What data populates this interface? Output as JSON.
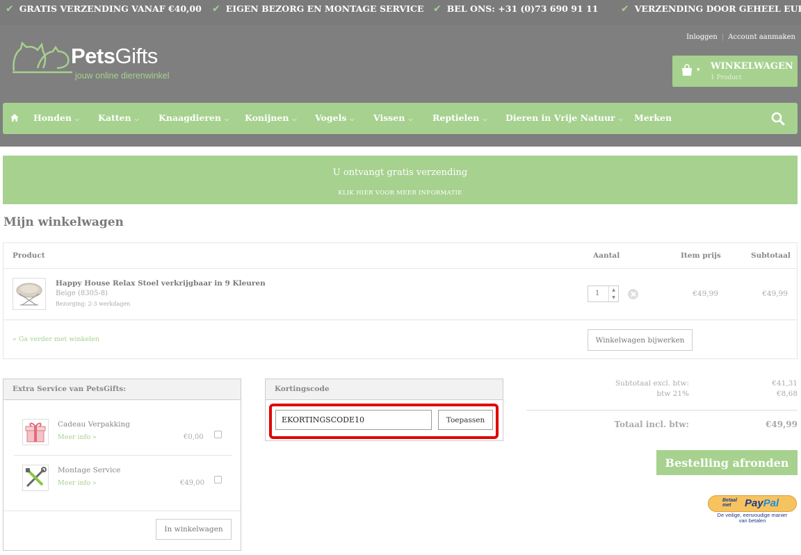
{
  "topbar": {
    "usps": [
      "GRATIS VERZENDING VANAF €40,00",
      "EIGEN BEZORG EN MONTAGE SERVICE",
      "BEL ONS: +31 (0)73 690 91 11",
      "VERZENDING DOOR GEHEEL EUROPA"
    ]
  },
  "header": {
    "logo_main": "Pets",
    "logo_light": "Gifts",
    "logo_tagline": "jouw online dierenwinkel",
    "login": "Inloggen",
    "register": "Account aanmaken",
    "cart_label": "WINKELWAGEN",
    "cart_count": "1 Product"
  },
  "nav": {
    "items": [
      "Honden",
      "Katten",
      "Knaagdieren",
      "Konijnen",
      "Vogels",
      "Vissen",
      "Reptielen",
      "Dieren in Vrije Natuur",
      "Merken"
    ]
  },
  "banner": {
    "title": "U ontvangt gratis verzending",
    "link": "KLIK HIER VOOR MEER INFORMATIE"
  },
  "page_title": "Mijn winkelwagen",
  "cart": {
    "headers": {
      "product": "Product",
      "qty": "Aantal",
      "price": "Item prijs",
      "subtotal": "Subtotaal"
    },
    "item": {
      "name": "Happy House Relax Stoel verkrijgbaar in 9 Kleuren",
      "variant": "Beige (8305-8)",
      "delivery": "Bezorging: 2-3 werkdagen",
      "qty": "1",
      "price": "€49,99",
      "subtotal": "€49,99"
    },
    "continue": "« Ga verder met winkelen",
    "update": "Winkelwagen bijwerken"
  },
  "extra": {
    "title": "Extra Service van PetsGifts:",
    "items": [
      {
        "name": "Cadeau Verpakking",
        "more": "Meer info »",
        "price": "€0,00"
      },
      {
        "name": "Montage Service",
        "more": "Meer info »",
        "price": "€49,00"
      }
    ],
    "add": "In winkelwagen"
  },
  "coupon": {
    "title": "Kortingscode",
    "value": "EKORTINGSCODE10",
    "apply": "Toepassen"
  },
  "totals": {
    "subtotal_label": "Subtotaal excl. btw:",
    "subtotal": "€41,31",
    "vat_label": "btw 21%",
    "vat": "€8,68",
    "total_label": "Totaal incl. btw:",
    "total": "€49,99",
    "checkout": "Bestelling afronden"
  },
  "paypal": {
    "small": "Betaal met",
    "logo_a": "Pay",
    "logo_b": "Pal",
    "tagline_1": "De veilige, eenvoudige manier",
    "tagline_2": "van betalen"
  },
  "colors": {
    "accent": "#a6d18f",
    "header": "#7f7f7f",
    "highlight": "#e20000"
  }
}
